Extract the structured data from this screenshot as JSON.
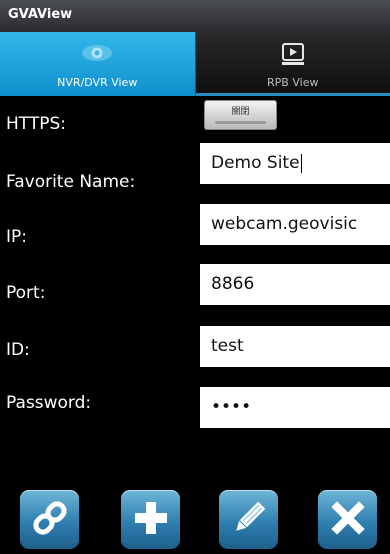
{
  "app": {
    "title": "GVAView"
  },
  "tabs": [
    {
      "label": "NVR/DVR View",
      "icon": "eye-icon",
      "active": true
    },
    {
      "label": "RPB View",
      "icon": "playback-icon",
      "active": false
    }
  ],
  "form": {
    "https": {
      "label": "HTTPS:",
      "toggle_text": "關閉"
    },
    "favorite_name": {
      "label": "Favorite Name:",
      "value": "Demo Site"
    },
    "ip": {
      "label": "IP:",
      "value": "webcam.geovisic"
    },
    "port": {
      "label": "Port:",
      "value": "8866"
    },
    "id": {
      "label": "ID:",
      "value": "test"
    },
    "password": {
      "label": "Password:",
      "value": "••••"
    }
  },
  "toolbar": {
    "buttons": [
      {
        "icon": "link-icon"
      },
      {
        "icon": "plus-icon"
      },
      {
        "icon": "pencil-icon"
      },
      {
        "icon": "close-icon"
      }
    ]
  },
  "colors": {
    "tab_active": "#1ea4df",
    "background": "#000000",
    "button": "#2f7fb0"
  }
}
